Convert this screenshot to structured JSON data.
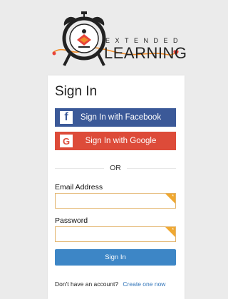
{
  "logo": {
    "top_text": "EXTENDED",
    "bottom_text": "LEARNING"
  },
  "signin_card": {
    "title": "Sign In",
    "facebook": {
      "icon": "f",
      "label": "Sign In with Facebook",
      "color": "#3b5998"
    },
    "google": {
      "icon": "G",
      "label": "Sign In with Google",
      "color": "#dd4b39"
    },
    "divider_text": "OR",
    "email": {
      "label": "Email Address",
      "value": "",
      "placeholder": ""
    },
    "password": {
      "label": "Password",
      "value": "",
      "placeholder": ""
    },
    "required_marker": "*",
    "submit_label": "Sign In",
    "submit_color": "#3d86c6",
    "footer_text": "Don't have an account?",
    "footer_link": "Create one now"
  }
}
